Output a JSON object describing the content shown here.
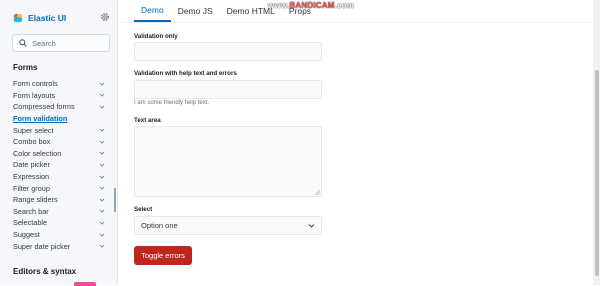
{
  "brand": {
    "name": "Elastic UI"
  },
  "search": {
    "placeholder": "Search"
  },
  "sidebar": {
    "section_forms": "Forms",
    "items": [
      {
        "label": "Form controls",
        "active": false
      },
      {
        "label": "Form layouts",
        "active": false
      },
      {
        "label": "Compressed forms",
        "active": false
      },
      {
        "label": "Form validation",
        "active": true
      },
      {
        "label": "Super select",
        "active": false
      },
      {
        "label": "Combo box",
        "active": false
      },
      {
        "label": "Color selection",
        "active": false
      },
      {
        "label": "Date picker",
        "active": false
      },
      {
        "label": "Expression",
        "active": false
      },
      {
        "label": "Filter group",
        "active": false
      },
      {
        "label": "Range sliders",
        "active": false
      },
      {
        "label": "Search bar",
        "active": false
      },
      {
        "label": "Selectable",
        "active": false
      },
      {
        "label": "Suggest",
        "active": false
      },
      {
        "label": "Super date picker",
        "active": false
      }
    ],
    "section_editors": "Editors & syntax"
  },
  "tabs": [
    {
      "label": "Demo",
      "selected": true
    },
    {
      "label": "Demo JS",
      "selected": false
    },
    {
      "label": "Demo HTML",
      "selected": false
    },
    {
      "label": "Props",
      "selected": false
    }
  ],
  "watermark": {
    "prefix": "www.",
    "brand": "BANDICAM",
    "suffix": ".com"
  },
  "form": {
    "validation_only_label": "Validation only",
    "validation_only_value": "",
    "validation_help_label": "Validation with help text and errors",
    "validation_help_value": "",
    "help_text": "I am some friendly help text.",
    "textarea_label": "Text area",
    "textarea_value": "",
    "select_label": "Select",
    "select_value": "Option one",
    "toggle_button": "Toggle errors"
  },
  "colors": {
    "accent": "#006bb8",
    "danger": "#bd271e",
    "badge": "#f04e98"
  }
}
